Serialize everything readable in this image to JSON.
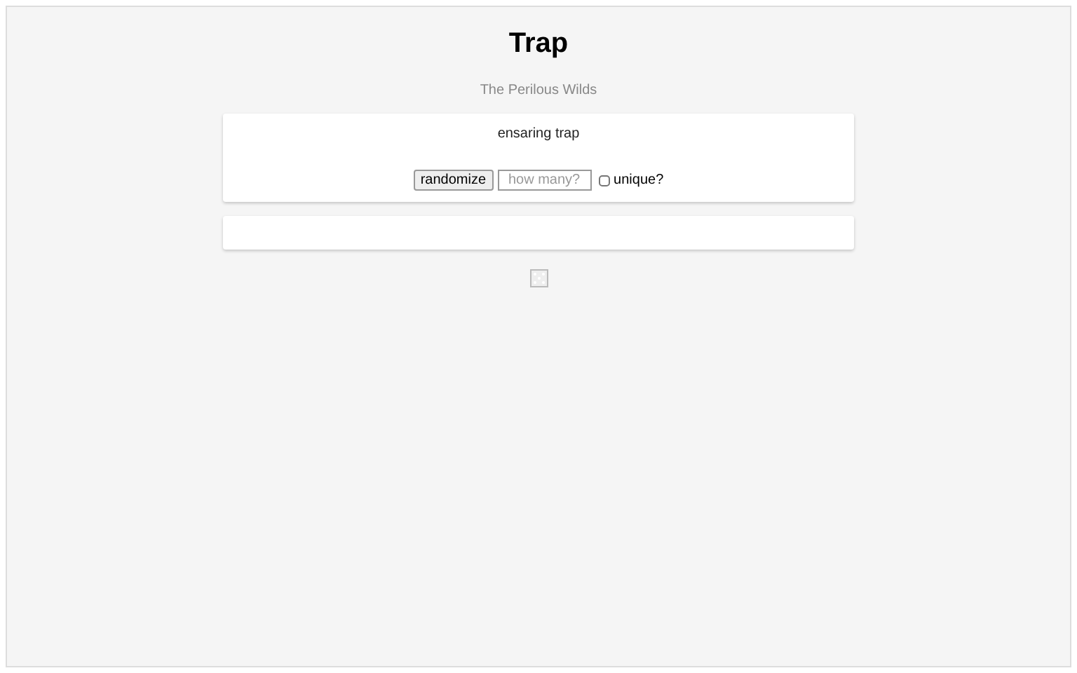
{
  "title": "Trap",
  "subtitle": "The Perilous Wilds",
  "result": "ensaring trap",
  "controls": {
    "button": "randomize",
    "count": {
      "placeholder": "how many?"
    },
    "unique": {
      "label": "unique?",
      "checked": false
    }
  }
}
